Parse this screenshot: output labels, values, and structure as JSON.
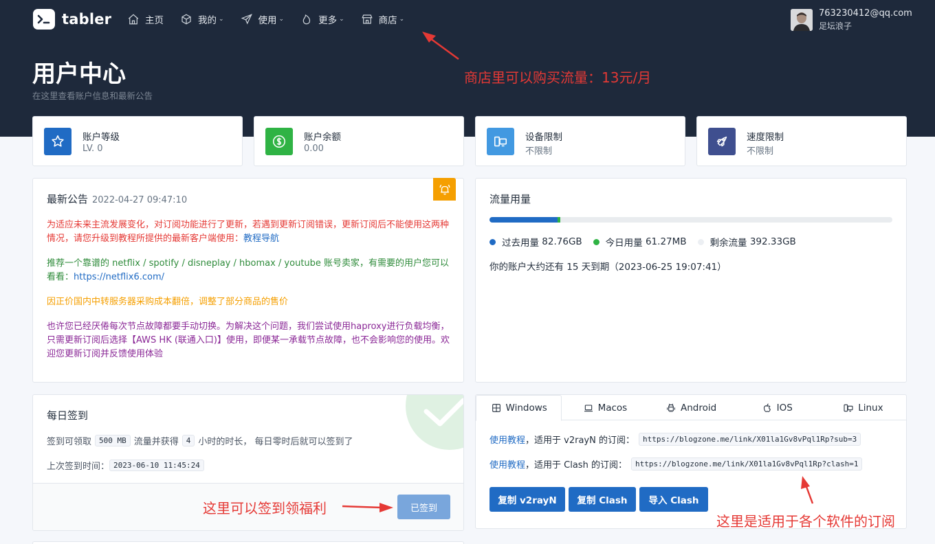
{
  "brand": {
    "name": "tabler"
  },
  "nav": [
    {
      "label": "主页",
      "icon": "home-icon",
      "caret": false
    },
    {
      "label": "我的",
      "icon": "cube-icon",
      "caret": true
    },
    {
      "label": "使用",
      "icon": "send-icon",
      "caret": true
    },
    {
      "label": "更多",
      "icon": "flame-icon",
      "caret": true
    },
    {
      "label": "商店",
      "icon": "store-icon",
      "caret": true
    }
  ],
  "user": {
    "email": "763230412@qq.com",
    "nickname": "足坛浪子"
  },
  "header": {
    "title": "用户中心",
    "subtitle": "在这里查看账户信息和最新公告"
  },
  "stats": [
    {
      "label": "账户等级",
      "value": "LV. 0",
      "icon": "star-icon",
      "color": "#206bc4"
    },
    {
      "label": "账户余额",
      "value": "0.00",
      "icon": "dollar-icon",
      "color": "#2fb344"
    },
    {
      "label": "设备限制",
      "value": "不限制",
      "icon": "devices-icon",
      "color": "#4299e1"
    },
    {
      "label": "速度限制",
      "value": "不限制",
      "icon": "rocket-icon",
      "color": "#3f4f8f"
    }
  ],
  "notice": {
    "title": "最新公告",
    "date": "2022-04-27 09:47:10",
    "p1": "为适应未来主流发展变化，对订阅功能进行了更新，若遇到更新订阅错误，更新订阅后不能使用这两种情况，请您升级到教程所提供的最新客户端使用：",
    "p1_link": "教程导航",
    "p2": "推荐一个靠谱的 netflix / spotify / disneplay / hbomax / youtube 账号卖家，有需要的用户您可以看看：",
    "p2_link": "https://netflix6.com/",
    "p3": "因正价国内中转服务器采购成本翻倍，调整了部分商品的售价",
    "p4": "也许您已经厌倦每次节点故障都要手动切换。为解决这个问题，我们尝试使用haproxy进行负载均衡，只需更新订阅后选择【AWS HK (联通入口)】使用，即便某一承载节点故障，也不会影响您的使用。欢迎您更新订阅并反馈使用体验"
  },
  "traffic": {
    "title": "流量用量",
    "used_label": "过去用量",
    "used": "82.76GB",
    "today_label": "今日用量",
    "today": "61.27MB",
    "remain_label": "剩余流量",
    "remain": "392.33GB",
    "used_fraction": 0.1695,
    "today_fraction": 0.006,
    "expire_text": "你的账户大约还有 15 天到期（2023-06-25 19:07:41）"
  },
  "checkin": {
    "title": "每日签到",
    "line1_a": "签到可领取",
    "traffic_amount": "500 MB",
    "line1_b": "流量并获得",
    "hours": "4",
    "line1_c": "小时的时长， 每日零时后就可以签到了",
    "last_label": "上次签到时间：",
    "last_time": "2023-06-10 11:45:24",
    "button": "已签到"
  },
  "subscribe": {
    "tabs": [
      {
        "label": "Windows",
        "icon": "windows-icon"
      },
      {
        "label": "Macos",
        "icon": "laptop-icon"
      },
      {
        "label": "Android",
        "icon": "android-icon"
      },
      {
        "label": "IOS",
        "icon": "apple-icon"
      },
      {
        "label": "Linux",
        "icon": "linux-icon"
      }
    ],
    "row1_link": "使用教程",
    "row1_text": "，适用于 v2rayN 的订阅：",
    "row1_url": "https://blogzone.me/link/X01la1Gv8vPql1Rp?sub=3",
    "row2_link": "使用教程",
    "row2_text": "，适用于 Clash 的订阅：",
    "row2_url": "https://blogzone.me/link/X01la1Gv8vPql1Rp?clash=1",
    "buttons": [
      "复制 v2rayN",
      "复制 Clash",
      "导入 Clash"
    ]
  },
  "annotations": {
    "store": "商店里可以购买流量：13元/月",
    "checkin": "这里可以签到领福利",
    "subscribe": "这里是适用于各个软件的订阅"
  }
}
